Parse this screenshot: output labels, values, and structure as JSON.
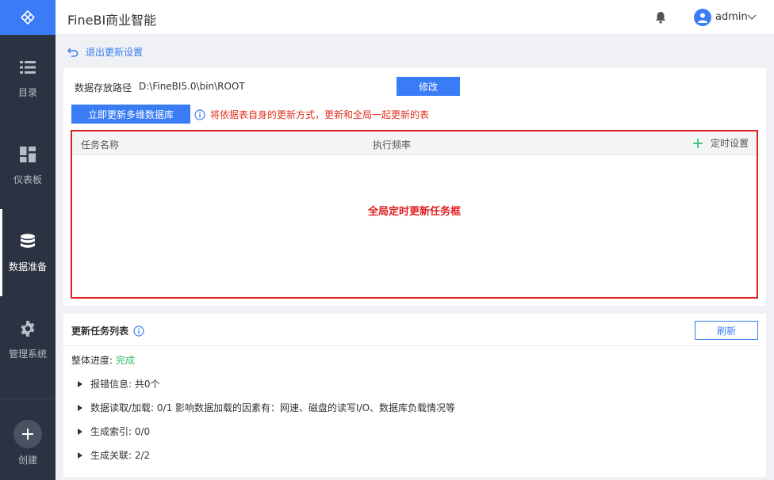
{
  "header": {
    "title": "FineBI商业智能",
    "user": "admin"
  },
  "sidebar": {
    "items": [
      {
        "label": "目录",
        "icon": "list-icon"
      },
      {
        "label": "仪表板",
        "icon": "dashboard-icon"
      },
      {
        "label": "数据准备",
        "icon": "database-icon",
        "active": true
      },
      {
        "label": "管理系统",
        "icon": "gear-icon"
      }
    ],
    "create_label": "创建"
  },
  "back_link": "退出更新设置",
  "settings": {
    "path_label": "数据存放路径",
    "path_value": "D:\\FineBI5.0\\bin\\ROOT",
    "modify_button": "修改",
    "update_button": "立即更新多维数据库",
    "info_text": "将依据表自身的更新方式，更新和全局一起更新的表"
  },
  "task_table": {
    "columns": [
      "任务名称",
      "执行频率"
    ],
    "timer_setting": "定时设置",
    "annotation": "全局定时更新任务框"
  },
  "update_list": {
    "title": "更新任务列表",
    "refresh_button": "刷新",
    "progress_label": "整体进度:",
    "progress_value": "完成",
    "details": [
      "报错信息: 共0个",
      "数据读取/加载: 0/1 影响数据加载的因素有：网速、磁盘的读写I/O、数据库负载情况等",
      "生成索引: 0/0",
      "生成关联: 2/2"
    ]
  },
  "colors": {
    "accent": "#3a7cf5",
    "sidebar": "#2b3241",
    "warning": "#e02020",
    "success": "#2ebd6b"
  }
}
